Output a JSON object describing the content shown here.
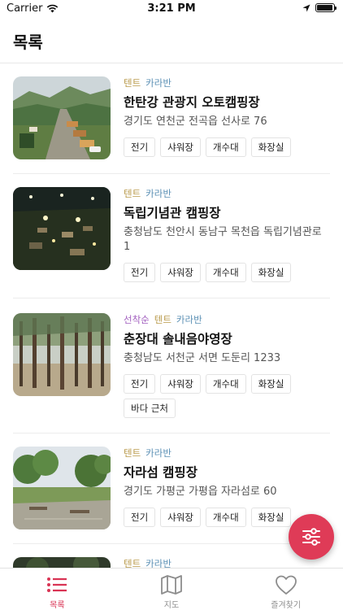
{
  "status": {
    "carrier": "Carrier",
    "time": "3:21 PM",
    "battery_level": 0.95
  },
  "header": {
    "title": "목록"
  },
  "campsites": [
    {
      "types": [
        "텐트",
        "카라반"
      ],
      "name": "한탄강 관광지 오토캠핑장",
      "address": "경기도 연천군 전곡읍 선사로 76",
      "tags": [
        "전기",
        "샤워장",
        "개수대",
        "화장실"
      ]
    },
    {
      "types": [
        "텐트",
        "카라반"
      ],
      "name": "독립기념관 캠핑장",
      "address": "충청남도 천안시 동남구 목천읍 독립기념관로 1",
      "tags": [
        "전기",
        "샤워장",
        "개수대",
        "화장실"
      ]
    },
    {
      "types": [
        "선착순",
        "텐트",
        "카라반"
      ],
      "name": "춘장대 솔내음야영장",
      "address": "충청남도 서천군 서면 도둔리 1233",
      "tags": [
        "전기",
        "샤워장",
        "개수대",
        "화장실",
        "바다 근처"
      ]
    },
    {
      "types": [
        "텐트",
        "카라반"
      ],
      "name": "자라섬 캠핑장",
      "address": "경기도 가평군 가평읍 자라섬로 60",
      "tags": [
        "전기",
        "샤워장",
        "개수대",
        "화장실"
      ]
    },
    {
      "types": [
        "텐트",
        "카라반"
      ]
    }
  ],
  "tabs": [
    {
      "label": "목록",
      "icon": "list-icon",
      "active": true
    },
    {
      "label": "지도",
      "icon": "map-icon",
      "active": false
    },
    {
      "label": "즐겨찾기",
      "icon": "heart-icon",
      "active": false
    }
  ],
  "colors": {
    "accent": "#df3b57",
    "tent": "#b99a4b",
    "caravan": "#5a8fb4",
    "first_come": "#a25fbf"
  }
}
